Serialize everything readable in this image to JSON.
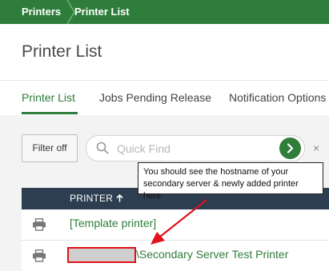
{
  "breadcrumb": {
    "items": [
      "Printers",
      "Printer List"
    ]
  },
  "page": {
    "title": "Printer List"
  },
  "tabs": [
    {
      "label": "Printer List",
      "active": true
    },
    {
      "label": "Jobs Pending Release",
      "active": false
    },
    {
      "label": "Notification Options",
      "active": false
    }
  ],
  "toolbar": {
    "filter_label": "Filter off",
    "search_placeholder": "Quick Find",
    "clear_symbol": "×"
  },
  "table": {
    "header": {
      "printer": "PRINTER"
    },
    "rows": [
      {
        "name": "[Template printer]",
        "redacted_prefix": false
      },
      {
        "name": "\\Secondary Server Test Printer",
        "redacted_prefix": true
      }
    ]
  },
  "annotation": {
    "text": "You should see the hostname of your secondary server & newly added printer here"
  },
  "colors": {
    "brand_green": "#2f7d3b",
    "header_dark": "#2c3e50",
    "annotation_red": "#e0121a"
  },
  "icons": {
    "search": "search-icon",
    "go": "chevron-right-icon",
    "sort": "arrow-up-icon",
    "printer": "printer-icon",
    "clear": "close-icon"
  }
}
